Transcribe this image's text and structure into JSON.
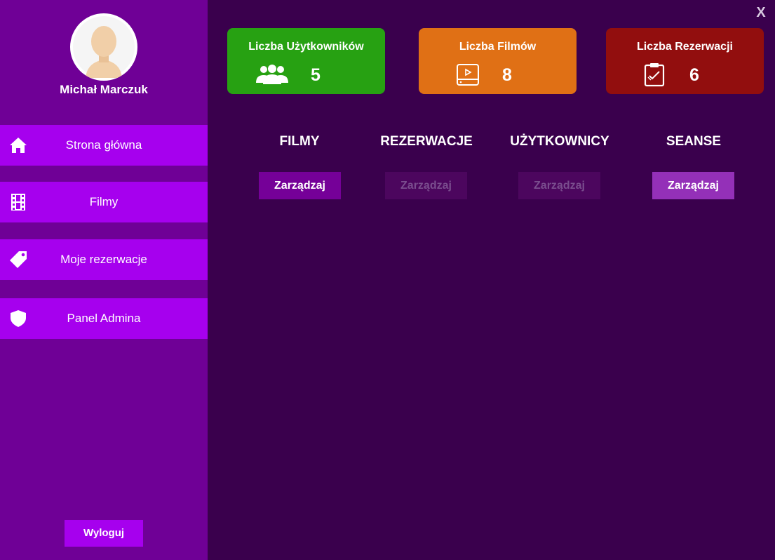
{
  "window": {
    "close_label": "X"
  },
  "user": {
    "name": "Michał Marczuk"
  },
  "sidebar": {
    "items": [
      {
        "label": "Strona główna",
        "icon": "home-icon"
      },
      {
        "label": "Filmy",
        "icon": "film-icon"
      },
      {
        "label": "Moje rezerwacje",
        "icon": "tag-icon"
      },
      {
        "label": "Panel Admina",
        "icon": "shield-icon"
      }
    ],
    "logout_label": "Wyloguj"
  },
  "stats": [
    {
      "title": "Liczba Użytkowników",
      "value": "5",
      "icon": "users-icon",
      "color": "#27a112"
    },
    {
      "title": "Liczba Filmów",
      "value": "8",
      "icon": "video-icon",
      "color": "#e07015"
    },
    {
      "title": "Liczba Rezerwacji",
      "value": "6",
      "icon": "clipboard-check-icon",
      "color": "#920e0e"
    }
  ],
  "sections": [
    {
      "title": "FILMY",
      "button_label": "Zarządzaj",
      "enabled": true
    },
    {
      "title": "REZERWACJE",
      "button_label": "Zarządzaj",
      "enabled": false
    },
    {
      "title": "UŻYTKOWNICY",
      "button_label": "Zarządzaj",
      "enabled": false
    },
    {
      "title": "SEANSE",
      "button_label": "Zarządzaj",
      "enabled": true
    }
  ],
  "colors": {
    "background": "#3a004d",
    "sidebar": "#6f0096",
    "accent": "#a600ee"
  }
}
